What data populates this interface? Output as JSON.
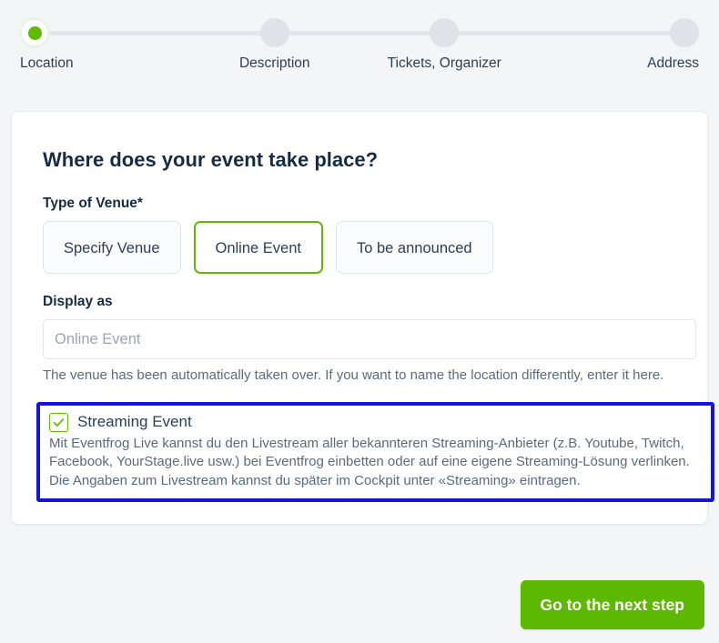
{
  "stepper": {
    "steps": [
      {
        "label": "Location",
        "state": "active"
      },
      {
        "label": "Description",
        "state": "inactive"
      },
      {
        "label": "Tickets, Organizer",
        "state": "inactive"
      },
      {
        "label": "Address",
        "state": "inactive"
      }
    ],
    "active_color": "#5fbb00",
    "inactive_color": "#dfe2e6"
  },
  "card": {
    "title": "Where does your event take place?",
    "venue_type": {
      "label": "Type of Venue*",
      "options": [
        {
          "label": "Specify Venue",
          "selected": false
        },
        {
          "label": "Online Event",
          "selected": true
        },
        {
          "label": "To be announced",
          "selected": false
        }
      ],
      "selected_border_color": "#5fbb00"
    },
    "display_as": {
      "label": "Display as",
      "value": "",
      "placeholder": "Online Event",
      "help_text": "The venue has been automatically taken over. If you want to name the location differently, enter it here."
    },
    "streaming": {
      "checked": true,
      "title": "Streaming Event",
      "description": "Mit Eventfrog Live kannst du den Livestream aller bekannteren Streaming-Anbieter (z.B. Youtube, Twitch, Facebook, YourStage.live usw.) bei Eventfrog einbetten oder auf eine eigene Streaming-Lösung verlinken. Die Angaben zum Livestream kannst du später im Cockpit unter «Streaming» eintragen.",
      "highlight_color": "#1414e0",
      "checkbox_color": "#5fbb00"
    }
  },
  "footer": {
    "next_button": "Go to the next step",
    "next_button_color": "#5cb800"
  }
}
